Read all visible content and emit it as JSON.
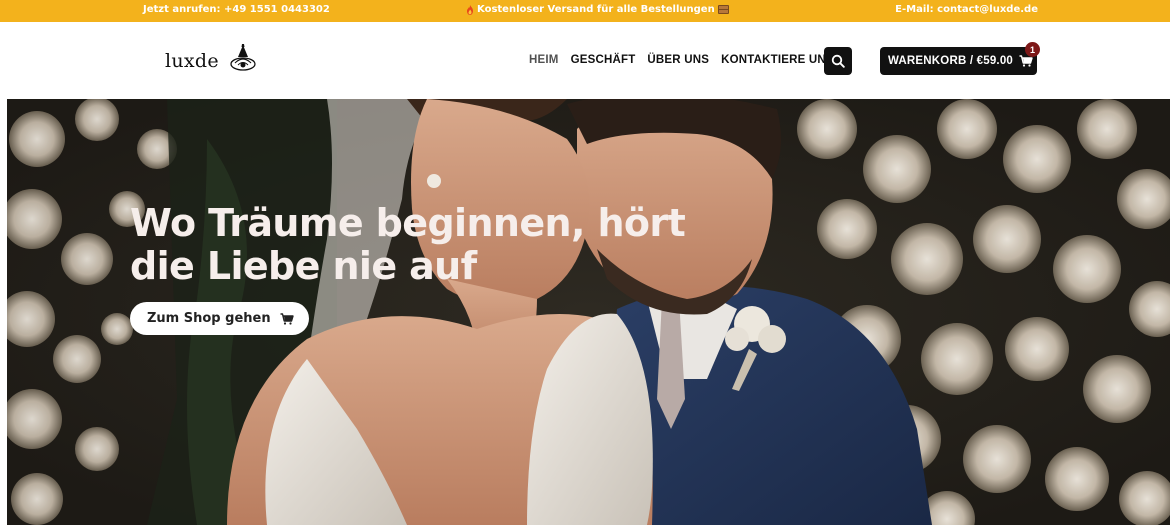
{
  "topbar": {
    "phone": "Jetzt anrufen: +49 1551 0443302",
    "shipping": "Kostenloser Versand für alle Bestellungen",
    "email": "E-Mail: contact@luxde.de",
    "bg_color": "#f3b21c"
  },
  "header": {
    "logo_text": "luxde",
    "nav": [
      {
        "label": "HEIM",
        "active": true
      },
      {
        "label": "GESCHÄFT",
        "active": false
      },
      {
        "label": "ÜBER UNS",
        "active": false
      },
      {
        "label": "KONTAKTIERE UNS",
        "active": false
      }
    ],
    "search_icon": "search-icon",
    "cart_label": "WARENKORB / €59.00",
    "cart_count": "1",
    "cart_icon": "cart-icon"
  },
  "hero": {
    "title": "Wo Träume beginnen, hört die Liebe nie auf",
    "cta_label": "Zum Shop gehen",
    "cta_icon": "cart-icon"
  }
}
